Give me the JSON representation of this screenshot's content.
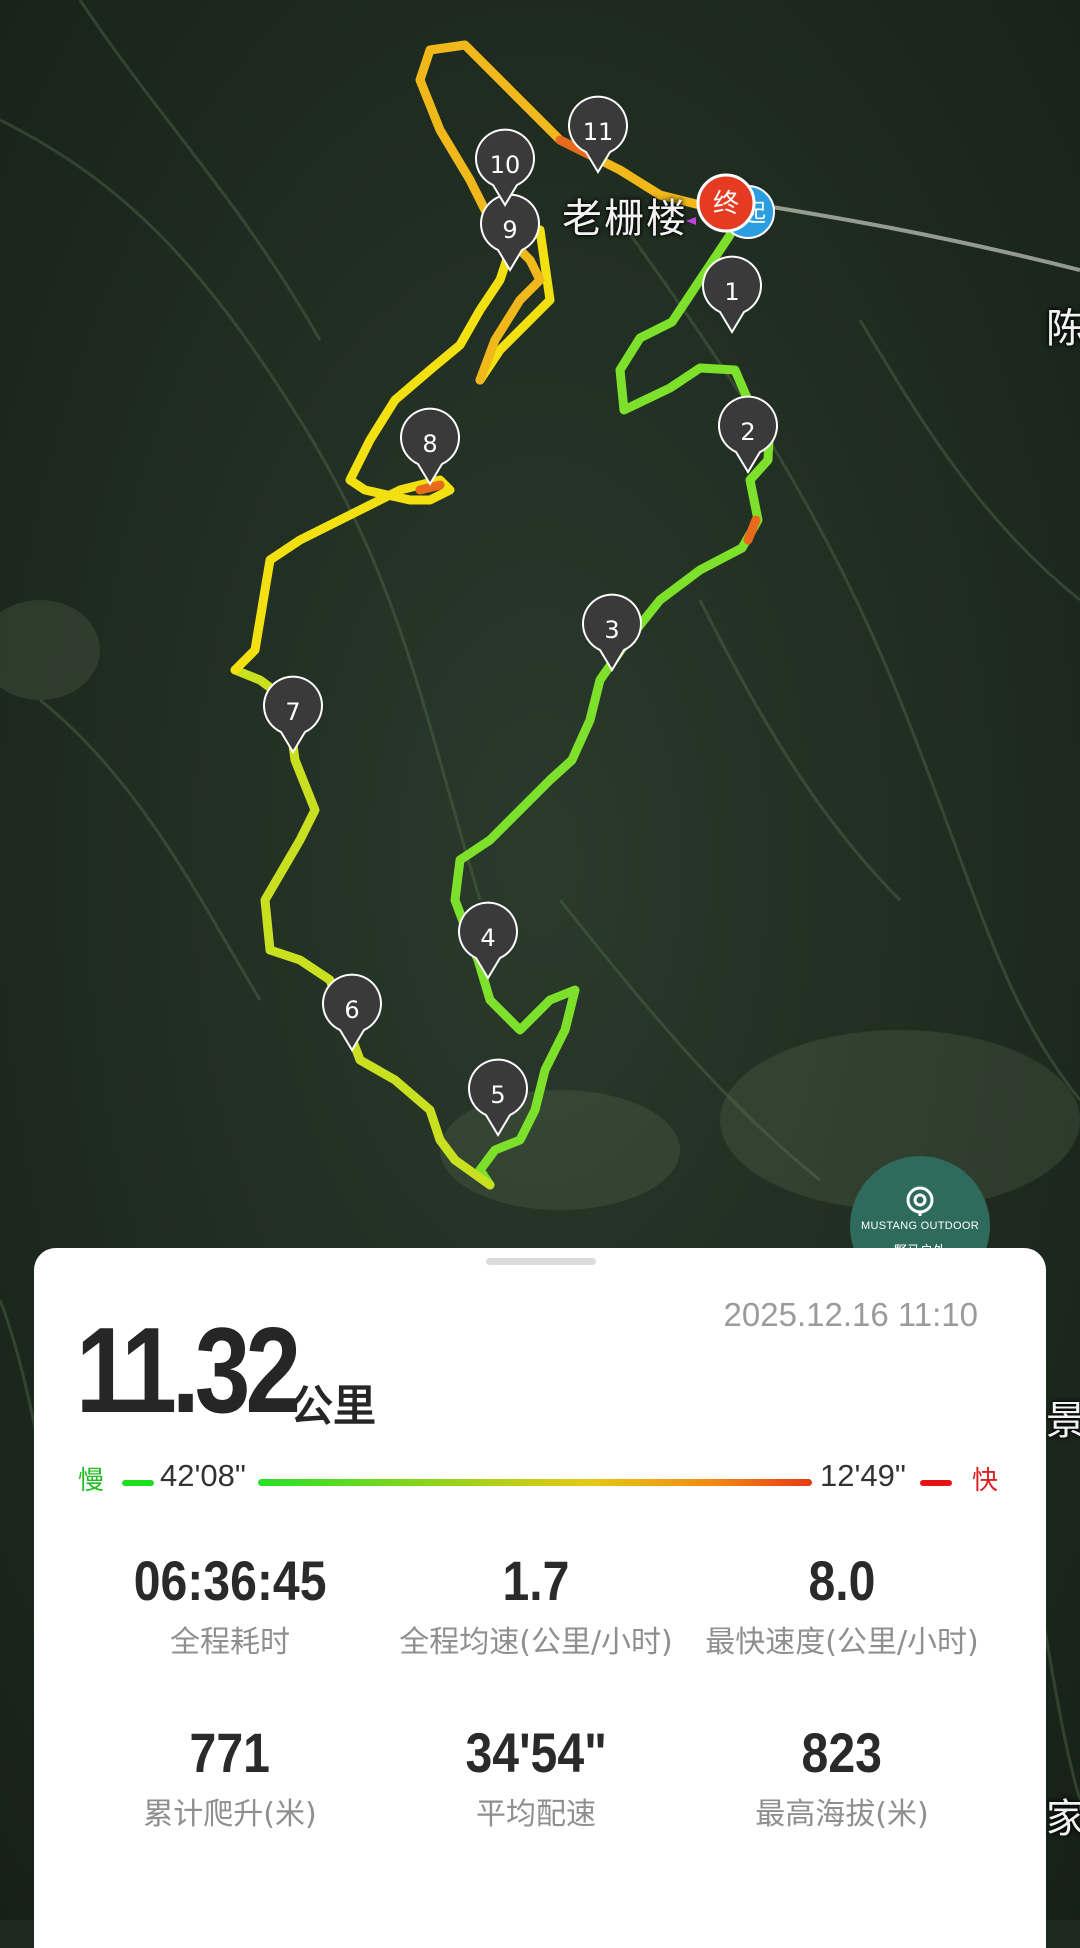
{
  "map": {
    "place_label": "老栅楼",
    "edge_label_top": "陈",
    "edge_label_mid": "景",
    "edge_label_bottom": "家",
    "end_marker": "终",
    "start_marker": "起",
    "km_markers": [
      "1",
      "2",
      "3",
      "4",
      "5",
      "6",
      "7",
      "8",
      "9",
      "10",
      "11"
    ]
  },
  "badge": {
    "name_en": "MUSTANG OUTDOOR",
    "name_cn": "野马户外"
  },
  "summary": {
    "distance": "11.32",
    "distance_unit": "公里",
    "datetime": "2025.12.16 11:10"
  },
  "pace_legend": {
    "slow_label": "慢",
    "fast_label": "快",
    "slowest_pace": "42'08\"",
    "fastest_pace": "12'49\""
  },
  "stats": [
    {
      "value": "06:36:45",
      "label": "全程耗时"
    },
    {
      "value": "1.7",
      "label": "全程均速(公里/小时)"
    },
    {
      "value": "8.0",
      "label": "最快速度(公里/小时)"
    },
    {
      "value": "771",
      "label": "累计爬升(米)"
    },
    {
      "value": "34'54\"",
      "label": "平均配速"
    },
    {
      "value": "823",
      "label": "最高海拔(米)"
    }
  ],
  "colors": {
    "slow": "#22dd22",
    "mid": "#f0d014",
    "fast": "#e8301a",
    "marker": "#3a3a3a",
    "badge_bg": "#2e6b5c"
  }
}
